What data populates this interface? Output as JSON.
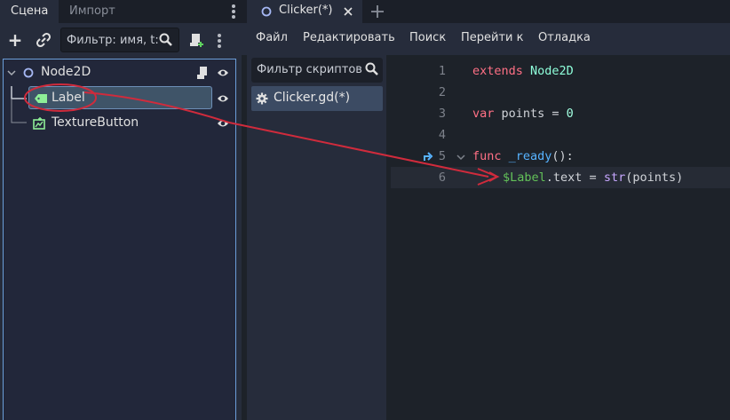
{
  "scene_dock": {
    "tabs": [
      "Сцена",
      "Импорт"
    ],
    "filter_placeholder": "Фильтр: имя, t:",
    "tree": [
      {
        "label": "Node2D",
        "icon": "node2d-circle-icon"
      },
      {
        "label": "Label",
        "icon": "label-icon"
      },
      {
        "label": "TextureButton",
        "icon": "texture-button-icon"
      }
    ]
  },
  "editor": {
    "tab_label": "Clicker(*)",
    "menu": [
      "Файл",
      "Редактировать",
      "Поиск",
      "Перейти к",
      "Отладка"
    ],
    "script_filter_placeholder": "Фильтр скриптов",
    "scripts": [
      "Clicker.gd(*)"
    ],
    "line_numbers": [
      "1",
      "2",
      "3",
      "4",
      "5",
      "6"
    ],
    "code": {
      "l1_kw": "extends",
      "l1_cls": "Node2D",
      "l3_kw": "var",
      "l3_rest": " points = ",
      "l3_num": "0",
      "l5_kw": "func",
      "l5_fn": " _ready",
      "l5_rest": "():",
      "l6_path": "$Label",
      "l6_rest": ".text = ",
      "l6_builtin": "str",
      "l6_args": "(points)"
    }
  },
  "colors": {
    "accent": "#6b9ed9",
    "arrow": "#d02b3c",
    "keyword": "#ff7085",
    "class": "#8effda",
    "nodepath": "#63c259"
  }
}
